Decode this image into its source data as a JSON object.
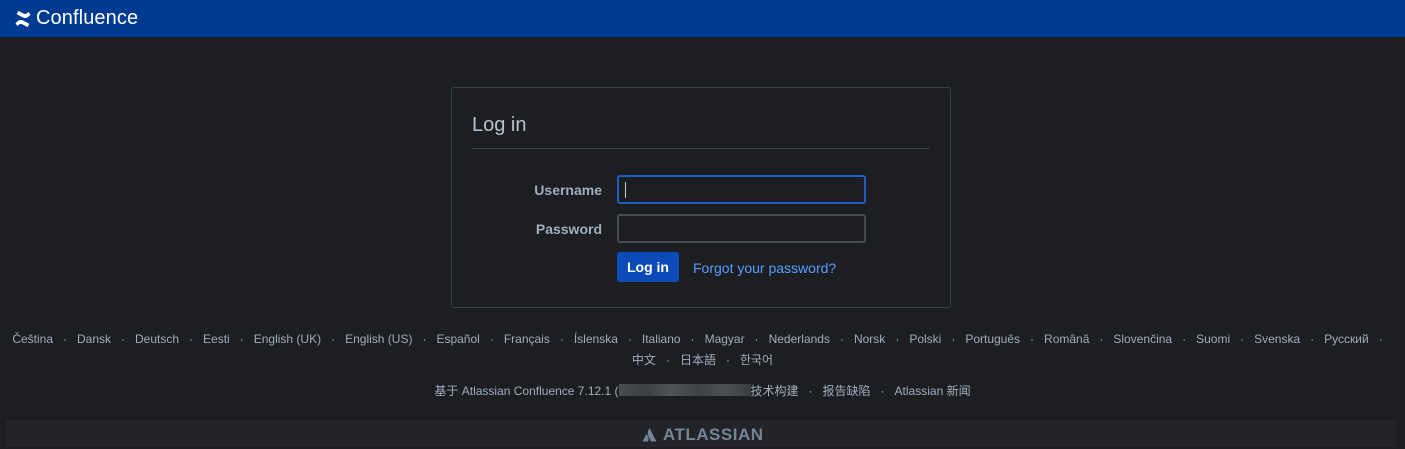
{
  "header": {
    "app_name": "Confluence",
    "brand_color": "#003b91",
    "icon": "confluence-logo-icon"
  },
  "login": {
    "title": "Log in",
    "username_label": "Username",
    "username_value": "",
    "password_label": "Password",
    "password_value": "",
    "submit_label": "Log in",
    "forgot_link": "Forgot your password?"
  },
  "footer": {
    "languages_row1": [
      "Čeština",
      "Dansk",
      "Deutsch",
      "Eesti",
      "English (UK)",
      "English (US)",
      "Español",
      "Français",
      "Íslenska",
      "Italiano",
      "Magyar",
      "Nederlands",
      "Norsk",
      "Polski",
      "Português",
      "Română",
      "Slovenčina",
      "Suomi",
      "Svenska",
      "Русский"
    ],
    "languages_row2": [
      "中文",
      "日本語",
      "한국어"
    ],
    "powered_prefix": "基于 Atlassian Confluence 7.12.1 (",
    "powered_suffix": "技术构建",
    "report_bug": "报告缺陷",
    "atlassian_news": "Atlassian 新闻",
    "atlassian_logo_text": "ATLASSIAN"
  }
}
